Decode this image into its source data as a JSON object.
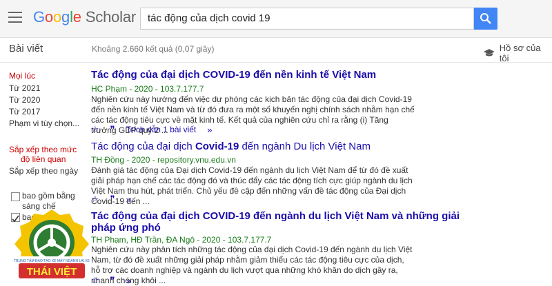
{
  "header": {
    "logo_google": [
      "G",
      "o",
      "o",
      "g",
      "l",
      "e"
    ],
    "logo_scholar": "Scholar",
    "search_value": "tác động của dịch covid 19"
  },
  "subbar": {
    "sidebar_title": "Bài viết",
    "results_count": "Khoảng 2.660 kết quả (0,07 giây)",
    "profile_label": "Hồ sơ của tôi"
  },
  "sidebar": {
    "time_filters": [
      "Mọi lúc",
      "Từ 2021",
      "Từ 2020",
      "Từ 2017",
      "Phạm vi tùy chọn..."
    ],
    "sort_relevance": [
      "Sắp xếp theo mức",
      "độ liên quan"
    ],
    "sort_date": "Sắp xếp theo ngày",
    "include_patents": [
      "bao gồm bằng",
      "sáng chế"
    ],
    "include_citations_prefix": "bao"
  },
  "results": [
    {
      "title_pre": "Tác động của đại dịch COVID-19 đến nền kinh tế Việt Nam",
      "meta": "HC Phạm - 2020 - 103.7.177.7",
      "snippet": "Nghiên cứu này hướng đến việc dự phóng các kịch bản tác động của đại dịch Covid-19 đến nền kinh tế Việt Nam và từ đó đưa ra một số khuyến nghị chính sách nhằm hạn chế các tác động tiêu cực về mặt kinh tế. Kết quả của nghiên cứu chỉ ra rằng (i) Tăng trưởng GDP quý 2 ...",
      "cited": "Trích dẫn 1 bài viết"
    },
    {
      "title_pre": "Tác động của đại dịch ",
      "title_bold": "Covid-19",
      "title_post": " đến ngành Du lịch Việt Nam",
      "meta": "TH Đồng - 2020 - repository.vnu.edu.vn",
      "snippet": "Đánh giá tác động của Đại dịch Covid-19 đến ngành du lịch Việt Nam để từ đó đề xuất giải pháp hạn chế các tác động đó và thúc đẩy các tác động tích cực giúp ngành du lịch Việt Nam thu hút, phát triển. Chủ yếu đề cập đến những vấn đề tác động của Đại dịch Covid-19 đến ..."
    },
    {
      "title_pre": "Tác động của đại dịch COVID-19 đến ngành du lịch Việt Nam và những giải",
      "title_line2": "pháp ứng phó",
      "meta": "TH Phạm, HĐ Trần, ĐA Ngô - 2020 - 103.7.177.7",
      "snippet": "Nghiên cứu này phân tích những tác động của đại dịch Covid-19 đến ngành du lịch Việt Nam, từ đó đề xuất những giải pháp nhằm giảm thiểu các tác động tiêu cực của dịch, hỗ trợ các doanh nghiệp và ngành du lịch vượt qua những khó khăn do dịch gây ra, nhanh chóng khôi ..."
    }
  ],
  "watermark": {
    "top_text": "TRUNG TÂM ĐÀO TẠO XE MÁY NGÀNH LÁI XE",
    "name": "THÁI VIỆT"
  },
  "colors": {
    "accent_blue": "#4285f4",
    "link": "#1a0dab",
    "meta_green": "#1a7a1a",
    "active_red": "#cc0000"
  }
}
